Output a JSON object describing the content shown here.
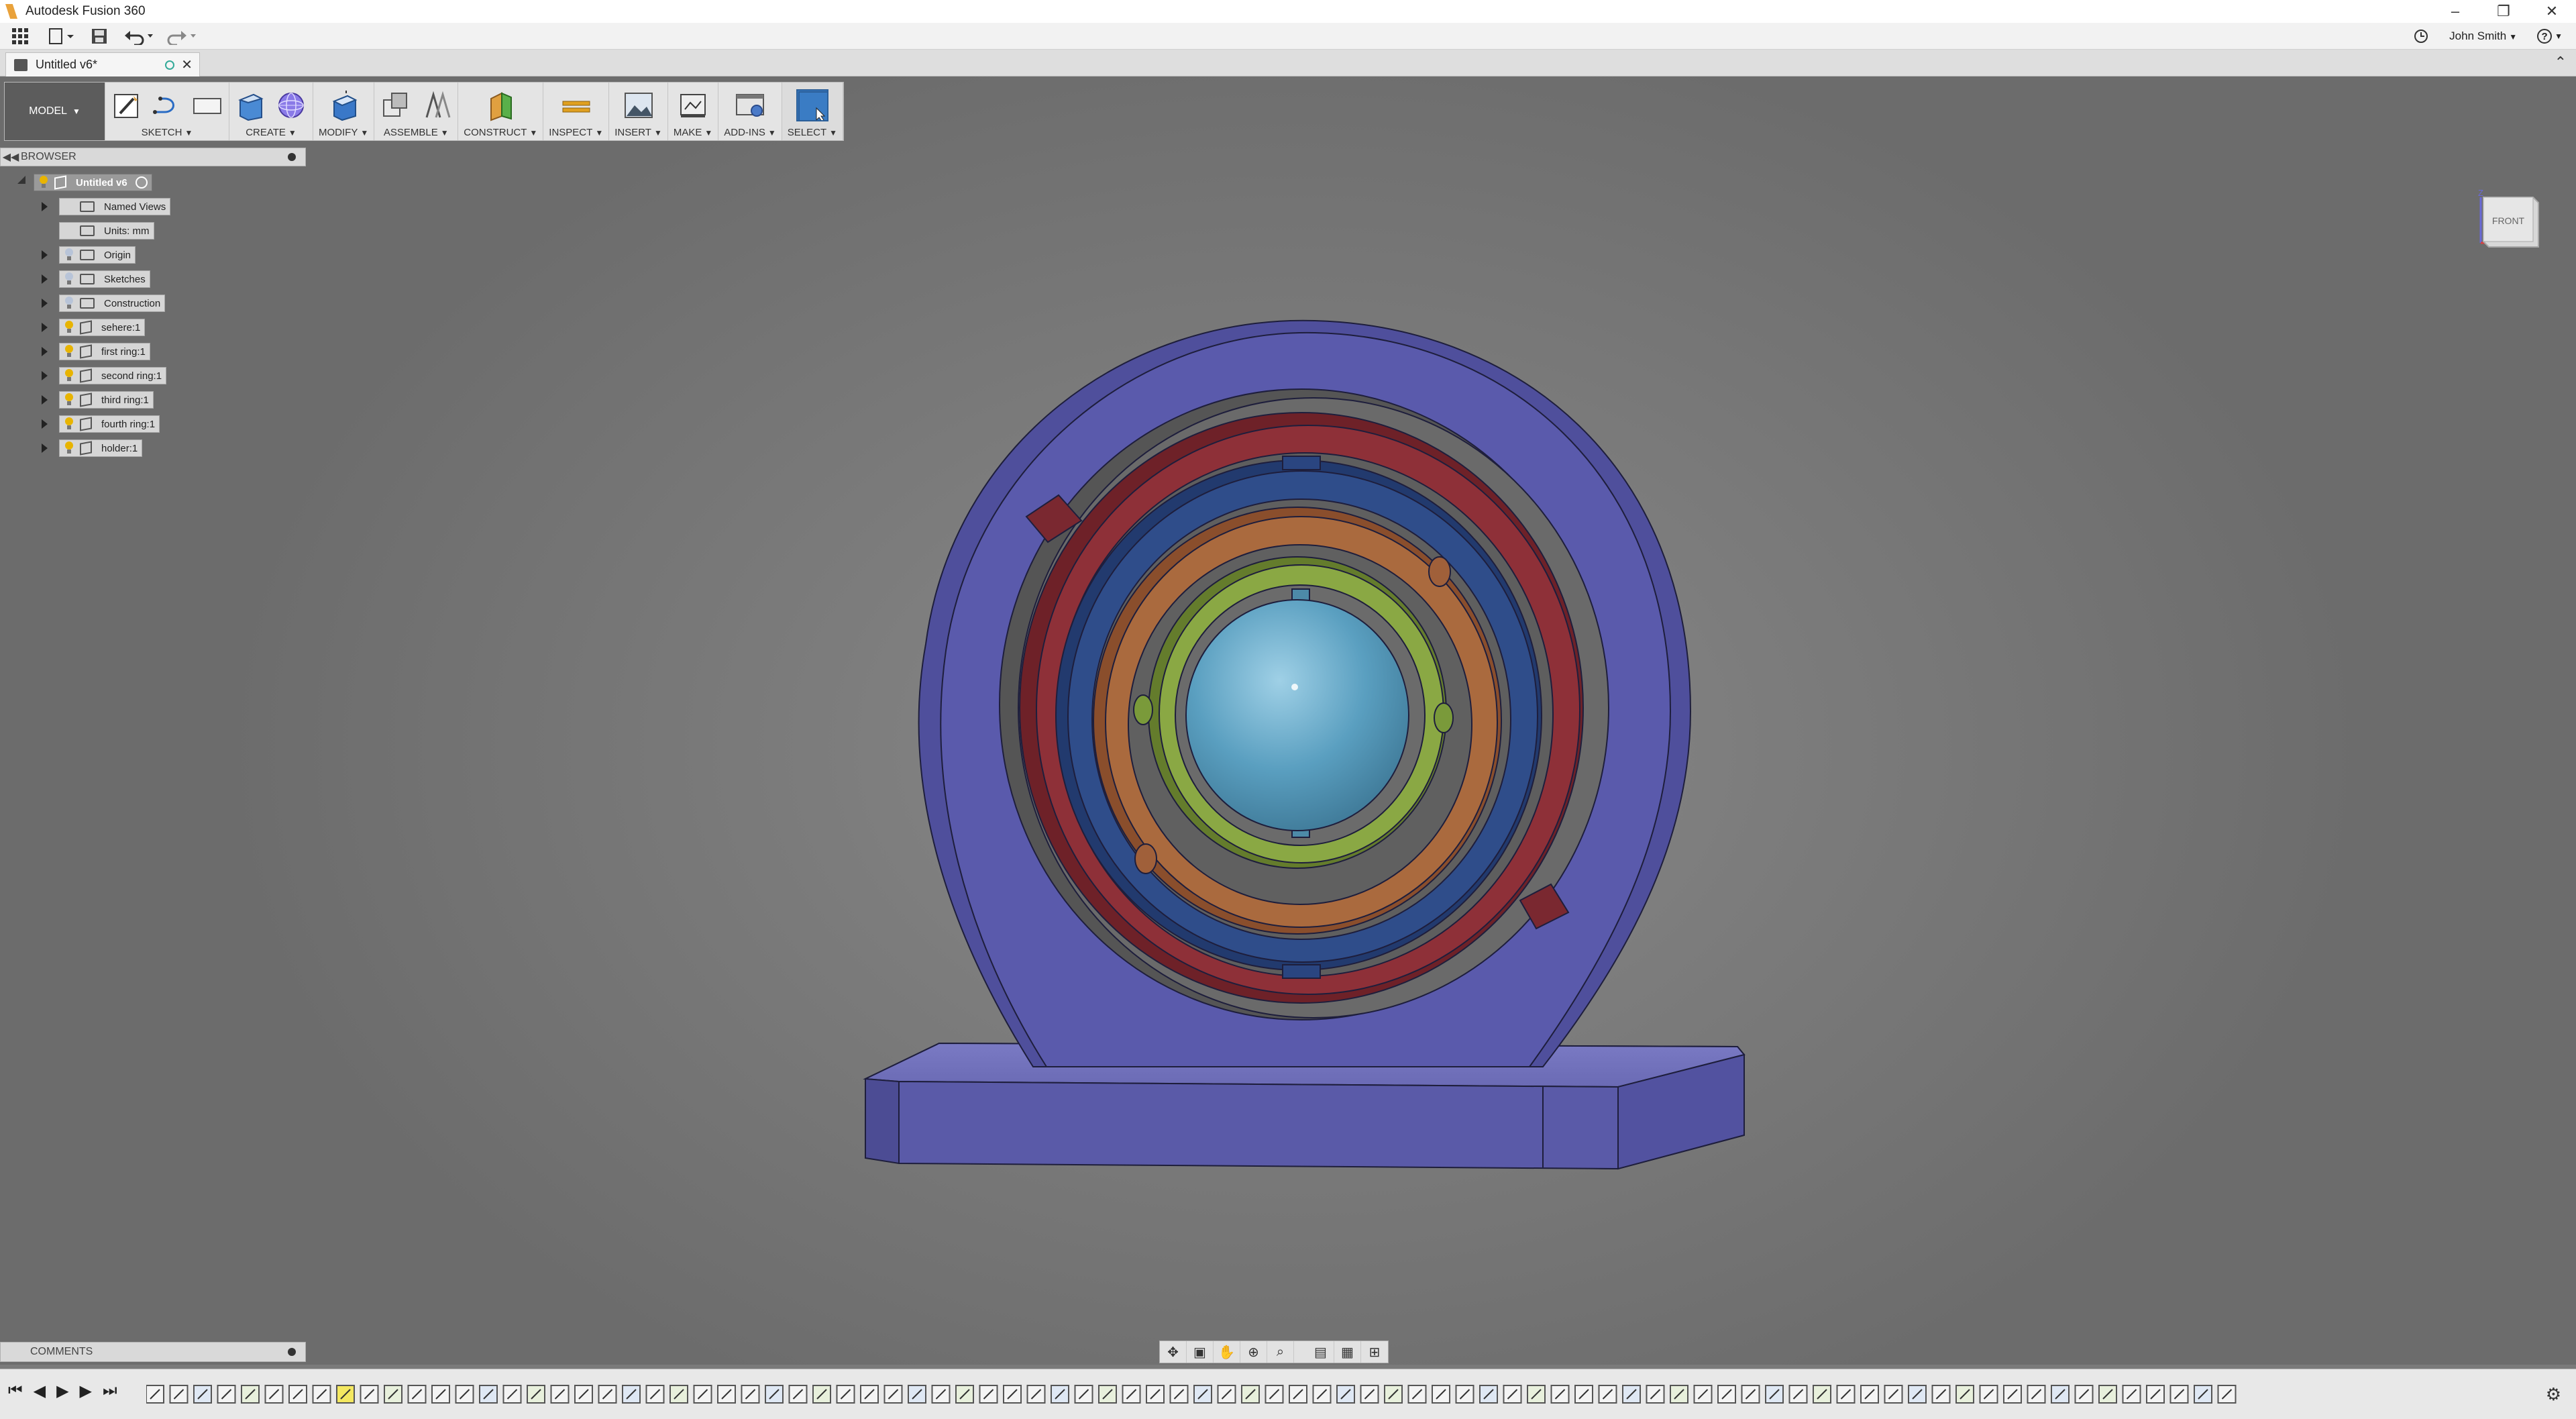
{
  "window": {
    "title": "Autodesk Fusion 360",
    "controls": [
      "–",
      "❐",
      "✕"
    ]
  },
  "qat": {
    "user_name": "John Smith",
    "help": "?"
  },
  "doc_tab": {
    "title": "Untitled v6*",
    "close": "✕"
  },
  "ribbon": {
    "workspace": "MODEL",
    "groups": [
      {
        "label": "SKETCH",
        "icons": [
          "sketch-icon",
          "line-icon",
          "rectangle-icon"
        ]
      },
      {
        "label": "CREATE",
        "icons": [
          "extrude-icon",
          "sphere-mesh-icon"
        ]
      },
      {
        "label": "MODIFY",
        "icons": [
          "press-pull-icon"
        ]
      },
      {
        "label": "ASSEMBLE",
        "icons": [
          "new-component-icon",
          "joint-icon"
        ]
      },
      {
        "label": "CONSTRUCT",
        "icons": [
          "plane-icon"
        ]
      },
      {
        "label": "INSPECT",
        "icons": [
          "measure-icon"
        ]
      },
      {
        "label": "INSERT",
        "icons": [
          "insert-image-icon"
        ]
      },
      {
        "label": "MAKE",
        "icons": [
          "print-3d-icon"
        ]
      },
      {
        "label": "ADD-INS",
        "icons": [
          "scripts-icon"
        ]
      },
      {
        "label": "SELECT",
        "icons": [
          "select-icon"
        ]
      }
    ]
  },
  "browser": {
    "header": "BROWSER",
    "root": "Untitled v6",
    "items": [
      {
        "label": "Named Views",
        "kind": "folder",
        "bulb": false,
        "expand": true
      },
      {
        "label": "Units: mm",
        "kind": "doc",
        "bulb": false,
        "expand": false
      },
      {
        "label": "Origin",
        "kind": "folder",
        "bulb": "dim",
        "expand": true
      },
      {
        "label": "Sketches",
        "kind": "folder",
        "bulb": "dim",
        "expand": true
      },
      {
        "label": "Construction",
        "kind": "folder",
        "bulb": "dim",
        "expand": true
      },
      {
        "label": "sehere:1",
        "kind": "component",
        "bulb": "on",
        "expand": true
      },
      {
        "label": "first ring:1",
        "kind": "component",
        "bulb": "on",
        "expand": true
      },
      {
        "label": "second ring:1",
        "kind": "component",
        "bulb": "on",
        "expand": true
      },
      {
        "label": "third ring:1",
        "kind": "component",
        "bulb": "on",
        "expand": true
      },
      {
        "label": "fourth ring:1",
        "kind": "component",
        "bulb": "on",
        "expand": true
      },
      {
        "label": "holder:1",
        "kind": "component",
        "bulb": "on",
        "expand": true
      }
    ]
  },
  "comments": {
    "header": "COMMENTS"
  },
  "viewcube": {
    "face": "FRONT",
    "axis": "Z"
  },
  "navbar": {
    "icons": [
      "orbit-icon",
      "look-at-icon",
      "pan-icon",
      "zoom-icon",
      "fit-icon",
      "display-settings-icon",
      "grid-icon",
      "viewports-icon"
    ]
  },
  "timeline": {
    "controls": [
      "⏮",
      "◀",
      "▶",
      "▶",
      "⏭"
    ],
    "feature_count": 88
  },
  "colors": {
    "holder": "#5a5aa6",
    "ring_red": "#8a2e38",
    "ring_blue": "#2e4a86",
    "ring_orange": "#a9653a",
    "ring_green": "#7e9a3a",
    "sphere": "#5aa0c0",
    "accent": "#3a7cc4"
  }
}
